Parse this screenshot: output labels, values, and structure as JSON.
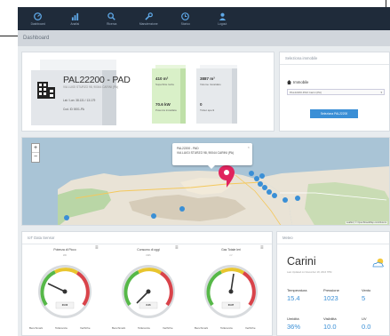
{
  "nav": {
    "items": [
      {
        "label": "Dashboard",
        "icon": "dashboard-icon"
      },
      {
        "label": "Analisi",
        "icon": "chart-icon"
      },
      {
        "label": "Ricerca",
        "icon": "search-icon"
      },
      {
        "label": "Manutenzione",
        "icon": "wrench-icon"
      },
      {
        "label": "Storico",
        "icon": "clock-icon"
      },
      {
        "label": "Logout",
        "icon": "user-icon"
      }
    ]
  },
  "page": {
    "title": "Dashboard"
  },
  "property": {
    "name": "PAL22200 - PAD",
    "address": "VIA LUIGI STURZO 98, 90044 CARINI (PA)",
    "lat_line": "Lat / Lon: 38.131 / 13.179",
    "code_line": "Cod. ID 0001-PA",
    "stats": [
      {
        "value": "410 m²",
        "label": "Superficie lorda"
      },
      {
        "value": "70.6 kW",
        "label": "Potenza installata"
      },
      {
        "value": "3887 m³",
        "label": "Volume riscaldato"
      },
      {
        "value": "0",
        "label": "Ticket aperti"
      }
    ]
  },
  "selector": {
    "title": "Seleziona immobile",
    "label": "Immobile",
    "value": "PAL22200-PAD Carini (PA)",
    "button": "Seleziona PAL22200"
  },
  "map": {
    "popup_title": "PAL22200 - PAD",
    "popup_address": "VIA LUIGI STURZO 98, 90044 CARINI (PA)",
    "attribution": "Leaflet | © OpenStreetMap contributors",
    "zoom_in": "+",
    "zoom_out": "−"
  },
  "sensors": {
    "title": "IoT Data Sensor",
    "gauges": [
      {
        "title": "Potenza di Picco",
        "unit": "kW",
        "value": "20.00",
        "foot": [
          "Benchmark",
          "Tolleranza",
          "Verifiche"
        ]
      },
      {
        "title": "Consumo di oggi",
        "unit": "kWh",
        "value": "8.36",
        "foot": [
          "Benchmark",
          "Tolleranza",
          "Verifiche"
        ]
      },
      {
        "title": "Gas Totale Ieri",
        "unit": "m³",
        "value": "60.87",
        "foot": [
          "Benchmark",
          "Tolleranza",
          "Verifiche"
        ]
      }
    ]
  },
  "weather": {
    "title": "Meteo",
    "city": "Carini",
    "updated": "Last Updated on November 18, 2016 7PM",
    "metrics": [
      {
        "label": "Temperatura",
        "value": "15.4"
      },
      {
        "label": "Pressione",
        "value": "1023"
      },
      {
        "label": "Vento",
        "value": "5"
      },
      {
        "label": "Umidità",
        "value": "36%"
      },
      {
        "label": "Visibilità",
        "value": "10.0"
      },
      {
        "label": "UV",
        "value": "0.0"
      }
    ]
  },
  "colors": {
    "nav_bg": "#1f2b3a",
    "accent": "#3a8fd6",
    "marker": "#e0245e",
    "pin": "#3a8fd6",
    "stat_green": "#d9f0c8"
  }
}
